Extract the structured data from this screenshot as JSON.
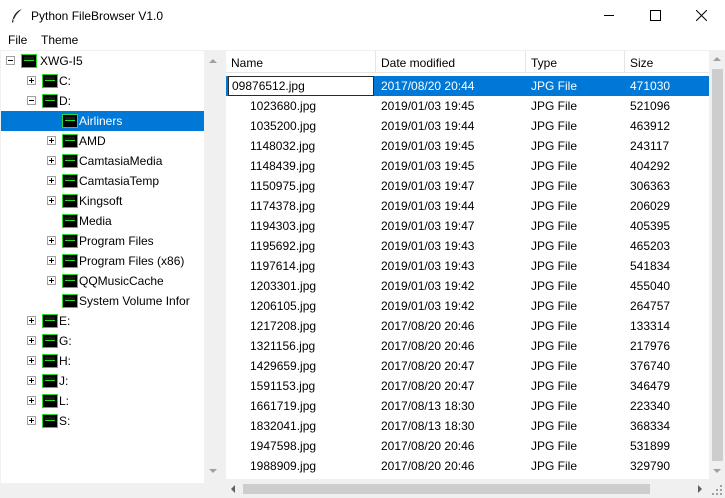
{
  "window": {
    "title": "Python FileBrowser V1.0",
    "icon": "feather-icon"
  },
  "menu": [
    {
      "label": "File"
    },
    {
      "label": "Theme"
    }
  ],
  "tree": {
    "items": [
      {
        "label": "XWG-I5",
        "level": 0,
        "expander": "minus",
        "selected": false
      },
      {
        "label": "C:",
        "level": 1,
        "expander": "plus",
        "selected": false
      },
      {
        "label": "D:",
        "level": 1,
        "expander": "minus",
        "selected": false
      },
      {
        "label": "Airliners",
        "level": 2,
        "expander": "none",
        "selected": true
      },
      {
        "label": "AMD",
        "level": 2,
        "expander": "plus",
        "selected": false
      },
      {
        "label": "CamtasiaMedia",
        "level": 2,
        "expander": "plus",
        "selected": false
      },
      {
        "label": "CamtasiaTemp",
        "level": 2,
        "expander": "plus",
        "selected": false
      },
      {
        "label": "Kingsoft",
        "level": 2,
        "expander": "plus",
        "selected": false
      },
      {
        "label": "Media",
        "level": 2,
        "expander": "none",
        "selected": false
      },
      {
        "label": "Program Files",
        "level": 2,
        "expander": "plus",
        "selected": false
      },
      {
        "label": "Program Files (x86)",
        "level": 2,
        "expander": "plus",
        "selected": false
      },
      {
        "label": "QQMusicCache",
        "level": 2,
        "expander": "plus",
        "selected": false
      },
      {
        "label": "System Volume Infor",
        "level": 2,
        "expander": "none",
        "selected": false
      },
      {
        "label": "E:",
        "level": 1,
        "expander": "plus",
        "selected": false
      },
      {
        "label": "G:",
        "level": 1,
        "expander": "plus",
        "selected": false
      },
      {
        "label": "H:",
        "level": 1,
        "expander": "plus",
        "selected": false
      },
      {
        "label": "J:",
        "level": 1,
        "expander": "plus",
        "selected": false
      },
      {
        "label": "L:",
        "level": 1,
        "expander": "plus",
        "selected": false
      },
      {
        "label": "S:",
        "level": 1,
        "expander": "plus",
        "selected": false
      }
    ]
  },
  "files": {
    "columns": [
      "Name",
      "Date modified",
      "Type",
      "Size"
    ],
    "editing_value": "09876512.jpg",
    "rows": [
      {
        "name": "09876512.jpg",
        "date": "2017/08/20 20:44",
        "type": "JPG File",
        "size": "471030",
        "selected": true
      },
      {
        "name": "1023680.jpg",
        "date": "2019/01/03 19:45",
        "type": "JPG File",
        "size": "521096"
      },
      {
        "name": "1035200.jpg",
        "date": "2019/01/03 19:44",
        "type": "JPG File",
        "size": "463912"
      },
      {
        "name": "1148032.jpg",
        "date": "2019/01/03 19:45",
        "type": "JPG File",
        "size": "243117"
      },
      {
        "name": "1148439.jpg",
        "date": "2019/01/03 19:45",
        "type": "JPG File",
        "size": "404292"
      },
      {
        "name": "1150975.jpg",
        "date": "2019/01/03 19:47",
        "type": "JPG File",
        "size": "306363"
      },
      {
        "name": "1174378.jpg",
        "date": "2019/01/03 19:44",
        "type": "JPG File",
        "size": "206029"
      },
      {
        "name": "1194303.jpg",
        "date": "2019/01/03 19:47",
        "type": "JPG File",
        "size": "405395"
      },
      {
        "name": "1195692.jpg",
        "date": "2019/01/03 19:43",
        "type": "JPG File",
        "size": "465203"
      },
      {
        "name": "1197614.jpg",
        "date": "2019/01/03 19:43",
        "type": "JPG File",
        "size": "541834"
      },
      {
        "name": "1203301.jpg",
        "date": "2019/01/03 19:42",
        "type": "JPG File",
        "size": "455040"
      },
      {
        "name": "1206105.jpg",
        "date": "2019/01/03 19:42",
        "type": "JPG File",
        "size": "264757"
      },
      {
        "name": "1217208.jpg",
        "date": "2017/08/20 20:46",
        "type": "JPG File",
        "size": "133314"
      },
      {
        "name": "1321156.jpg",
        "date": "2017/08/20 20:46",
        "type": "JPG File",
        "size": "217976"
      },
      {
        "name": "1429659.jpg",
        "date": "2017/08/20 20:47",
        "type": "JPG File",
        "size": "376740"
      },
      {
        "name": "1591153.jpg",
        "date": "2017/08/20 20:47",
        "type": "JPG File",
        "size": "346479"
      },
      {
        "name": "1661719.jpg",
        "date": "2017/08/13 18:30",
        "type": "JPG File",
        "size": "223340"
      },
      {
        "name": "1832041.jpg",
        "date": "2017/08/13 18:30",
        "type": "JPG File",
        "size": "368334"
      },
      {
        "name": "1947598.jpg",
        "date": "2017/08/20 20:46",
        "type": "JPG File",
        "size": "531899"
      },
      {
        "name": "1988909.jpg",
        "date": "2017/08/20 20:46",
        "type": "JPG File",
        "size": "329790"
      }
    ]
  },
  "colors": {
    "selection": "#0078d7",
    "drive_icon_outline": "#2bdb2b"
  }
}
